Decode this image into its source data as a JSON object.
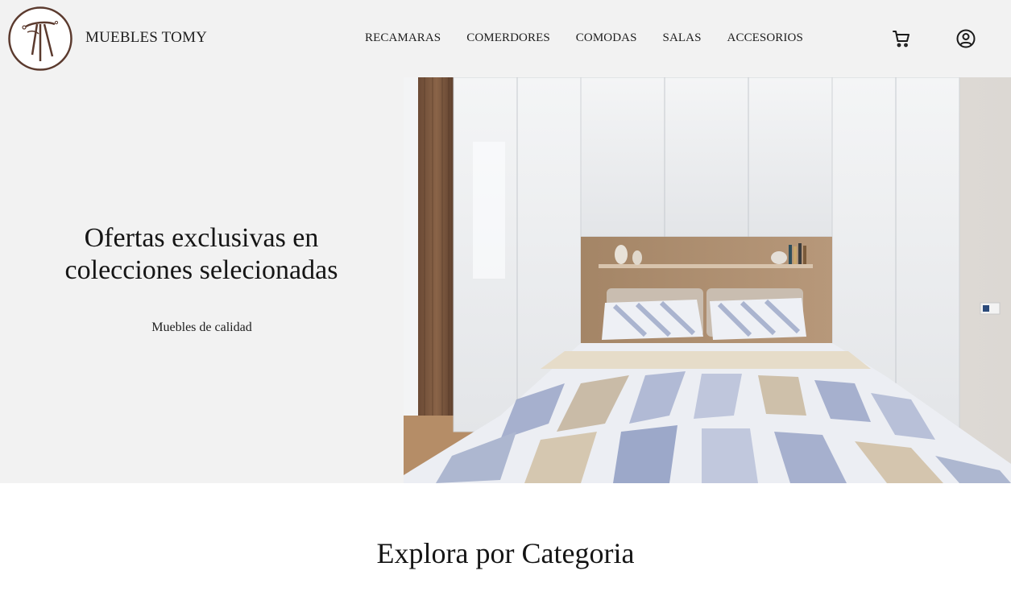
{
  "brand": {
    "name": "MUEBLES TOMY",
    "logo_icon": "brand-monogram-logo",
    "logo_color": "#5b3a2e"
  },
  "nav": {
    "items": [
      {
        "label": "RECAMARAS"
      },
      {
        "label": "COMERDORES"
      },
      {
        "label": "COMODAS"
      },
      {
        "label": "SALAS"
      },
      {
        "label": "ACCESORIOS"
      }
    ]
  },
  "header_icons": {
    "cart": "cart-icon",
    "user": "user-account-icon"
  },
  "hero": {
    "title": "Ofertas exclusivas en\ncolecciones selecionadas",
    "subtitle": "Muebles de calidad",
    "image": "bedroom-photo"
  },
  "sections": {
    "categories_title": "Explora por Categoria"
  },
  "colors": {
    "header_bg": "#f2f2f2",
    "page_bg": "#ffffff",
    "text": "#1d1d1d"
  }
}
